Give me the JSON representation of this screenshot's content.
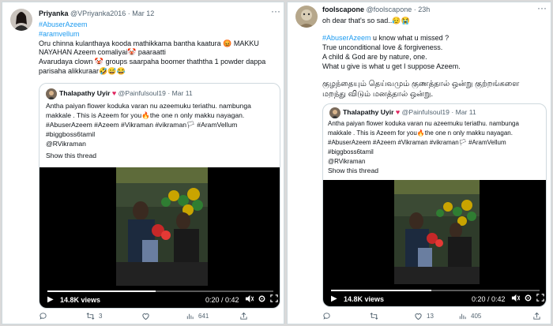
{
  "left": {
    "user": {
      "name": "Priyanka",
      "handle": "@VPriyanka2016 · Mar 12"
    },
    "tweet_lines": [
      "#AbuserAzeem",
      "#aramvellum",
      "Oru chinna kulanthaya kooda mathikkama bantha kaatura 😡 MAKKU",
      "NAYAHAN Azeem comaliyai🤡 paaraatti",
      "Avarudaya clown 🤡 groups saarpaha boomer thaththa 1 powder dappa",
      "parisaha alikkuraar🤣😅😂"
    ],
    "quote": {
      "name": "Thalapathy Uyir",
      "handle": "@Painfulsoul19 · Mar 11",
      "lines": [
        "Antha paiyan flower koduka varan nu azeemuku teriathu. nambunga",
        "makkale . This is Azeem for you🔥the one n only makku nayagan.",
        "#AbuserAzeem #Azeem #Vikraman #vikraman🏳 #AramVellum",
        "#biggboss6tamil",
        "@RVikraman"
      ],
      "show_thread": "Show this thread"
    },
    "video": {
      "views": "14.8K views",
      "time": "0:20 / 0:42",
      "progress": 0.48
    },
    "actions": {
      "replies": "",
      "retweets": "3",
      "likes": "",
      "views": "641"
    }
  },
  "right": {
    "user": {
      "name": "foolscapone",
      "handle": "@foolscapone · 23h"
    },
    "tweet_lines": [
      "oh dear that's so sad..😥😭",
      "",
      "#AbuserAzeem u know what u missed ?",
      "True unconditional love & forgiveness.",
      "A child & God are by nature, one.",
      "What u give is what u get I suppose Azeem.",
      "",
      "குழந்தையும் தெய்வமும் குணத்தால் ஒன்று குற்றங்களை",
      "மறந்து விடும் மனத்தால் ஒன்று."
    ],
    "quote": {
      "name": "Thalapathy Uyir",
      "handle": "@Painfulsoul19 · Mar 11",
      "lines": [
        "Antha paiyan flower koduka varan nu azeemuku teriathu. nambunga",
        "makkale . This is Azeem for you🔥the one n only makku nayagan.",
        "#AbuserAzeem #Azeem #Vikraman #vikraman🏳 #AramVellum",
        "#biggboss6tamil",
        "@RVikraman"
      ],
      "show_thread": "Show this thread"
    },
    "video": {
      "views": "14.8K views",
      "time": "0:20 / 0:42",
      "progress": 0.48
    },
    "actions": {
      "replies": "",
      "retweets": "",
      "likes": "13",
      "views": "405"
    }
  },
  "colors": {
    "link": "#1d9bf0",
    "heart": "#e0245e",
    "muted": "#536471",
    "border": "#cfd9de"
  },
  "icons": [
    "more-icon",
    "reply-icon",
    "retweet-icon",
    "like-icon",
    "views-icon",
    "share-icon",
    "play-icon",
    "volume-icon",
    "settings-icon",
    "fullscreen-icon"
  ]
}
